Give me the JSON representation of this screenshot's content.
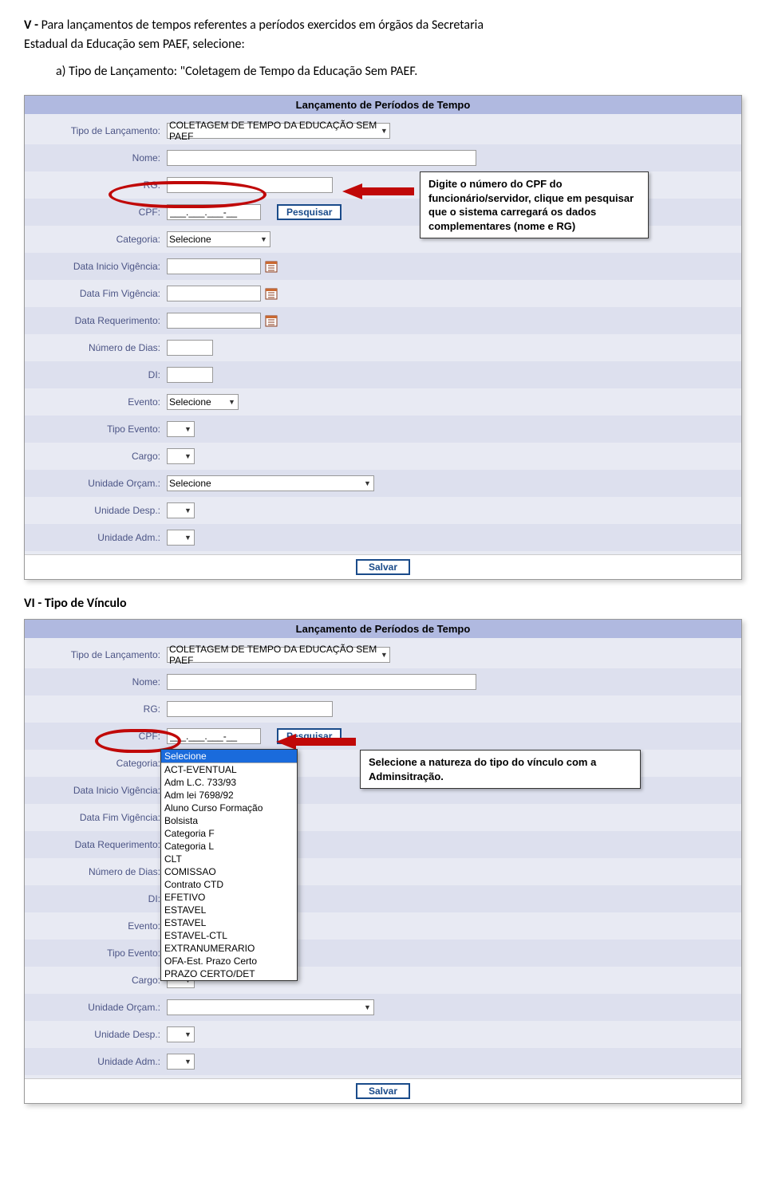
{
  "intro": {
    "heading_prefix": "V - ",
    "heading_rest": "Para lançamentos de tempos referentes a períodos exercidos em órgãos da Secretaria",
    "line2": "Estadual da Educação sem PAEF, selecione:",
    "item_a": "a)  Tipo de Lançamento: \"Coletagem de Tempo da Educação Sem PAEF."
  },
  "form1": {
    "title": "Lançamento de Períodos de Tempo",
    "labels": {
      "tipo_lanc": "Tipo de Lançamento:",
      "nome": "Nome:",
      "rg": "RG:",
      "cpf": "CPF:",
      "categoria": "Categoria:",
      "data_inicio": "Data Inicio Vigência:",
      "data_fim": "Data Fim Vigência:",
      "data_req": "Data Requerimento:",
      "num_dias": "Número de Dias:",
      "di": "DI:",
      "evento": "Evento:",
      "tipo_evento": "Tipo Evento:",
      "cargo": "Cargo:",
      "unid_orcam": "Unidade Orçam.:",
      "unid_desp": "Unidade Desp.:",
      "unid_adm": "Unidade Adm.:"
    },
    "values": {
      "tipo_lanc": "COLETAGEM DE TEMPO DA EDUCAÇÃO SEM PAEF",
      "cpf": "___.___.___-__",
      "categoria": "Selecione",
      "evento": "Selecione",
      "unid_orcam": "Selecione"
    },
    "buttons": {
      "pesquisar": "Pesquisar",
      "salvar": "Salvar"
    },
    "callout": "Digite o número do CPF do funcionário/servidor, clique em pesquisar que o sistema carregará os dados complementares (nome e RG)"
  },
  "section2": {
    "heading": "VI - Tipo de Vínculo"
  },
  "form2": {
    "title": "Lançamento de Períodos de Tempo",
    "labels": {
      "tipo_lanc": "Tipo de Lançamento:",
      "nome": "Nome:",
      "rg": "RG:",
      "cpf": "CPF:",
      "categoria": "Categoria:",
      "data_inicio": "Data Inicio Vigência:",
      "data_fim": "Data Fim Vigência:",
      "data_req": "Data Requerimento:",
      "num_dias": "Número de Dias:",
      "di": "DI:",
      "evento": "Evento:",
      "tipo_evento": "Tipo Evento:",
      "cargo": "Cargo:",
      "unid_orcam": "Unidade Orçam.:",
      "unid_desp": "Unidade Desp.:",
      "unid_adm": "Unidade Adm.:"
    },
    "values": {
      "tipo_lanc": "COLETAGEM DE TEMPO DA EDUCAÇÃO SEM PAEF",
      "cpf": "___.___.___-__",
      "categoria": "Selecione",
      "evento": "Selecione"
    },
    "buttons": {
      "pesquisar": "Pesquisar",
      "salvar": "Salvar"
    },
    "callout": "Selecione a natureza do tipo do vínculo com a Adminsitração.",
    "dropdown": {
      "highlight": "Selecione",
      "options": [
        "ACT-EVENTUAL",
        "Adm L.C. 733/93",
        "Adm lei 7698/92",
        "Aluno Curso Formação",
        "Bolsista",
        "Categoria F",
        "Categoria L",
        "CLT",
        "COMISSAO",
        "Contrato CTD",
        "EFETIVO",
        "ESTAVEL",
        "ESTAVEL",
        "ESTAVEL-CTL",
        "EXTRANUMERARIO",
        "OFA-Est. Prazo Certo",
        "PRAZO CERTO/DET"
      ]
    }
  }
}
